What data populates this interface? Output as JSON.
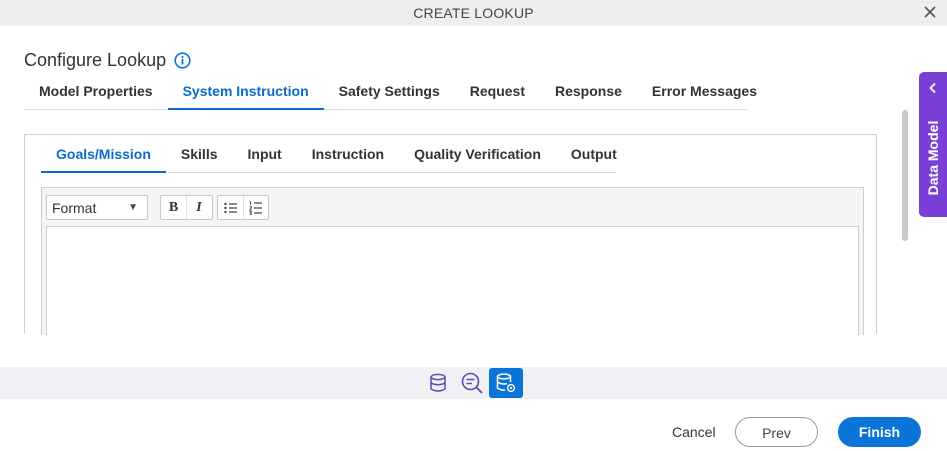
{
  "dialog": {
    "title": "CREATE LOOKUP",
    "close_icon": "close-icon"
  },
  "page": {
    "title": "Configure Lookup",
    "info_icon": "info-icon"
  },
  "main_tabs": [
    {
      "label": "Model Properties",
      "active": false
    },
    {
      "label": "System Instruction",
      "active": true
    },
    {
      "label": "Safety Settings",
      "active": false
    },
    {
      "label": "Request",
      "active": false
    },
    {
      "label": "Response",
      "active": false
    },
    {
      "label": "Error Messages",
      "active": false
    }
  ],
  "sub_tabs": [
    {
      "label": "Goals/Mission",
      "active": true
    },
    {
      "label": "Skills",
      "active": false
    },
    {
      "label": "Input",
      "active": false
    },
    {
      "label": "Instruction",
      "active": false
    },
    {
      "label": "Quality Verification",
      "active": false
    },
    {
      "label": "Output",
      "active": false
    }
  ],
  "editor": {
    "format_label": "Format",
    "bold_label": "B",
    "italic_label": "I",
    "content": ""
  },
  "side_panel": {
    "label": "Data Model"
  },
  "bottom_bar": {
    "icons": [
      "database-icon",
      "chat-search-icon",
      "database-settings-icon"
    ],
    "active_index": 2
  },
  "footer": {
    "cancel_label": "Cancel",
    "prev_label": "Prev",
    "finish_label": "Finish"
  },
  "colors": {
    "accent": "#0b74d9",
    "tab_active": "#0b6bcb",
    "side_panel": "#7a3fd6",
    "titlebar_bg": "#eeeeee"
  }
}
